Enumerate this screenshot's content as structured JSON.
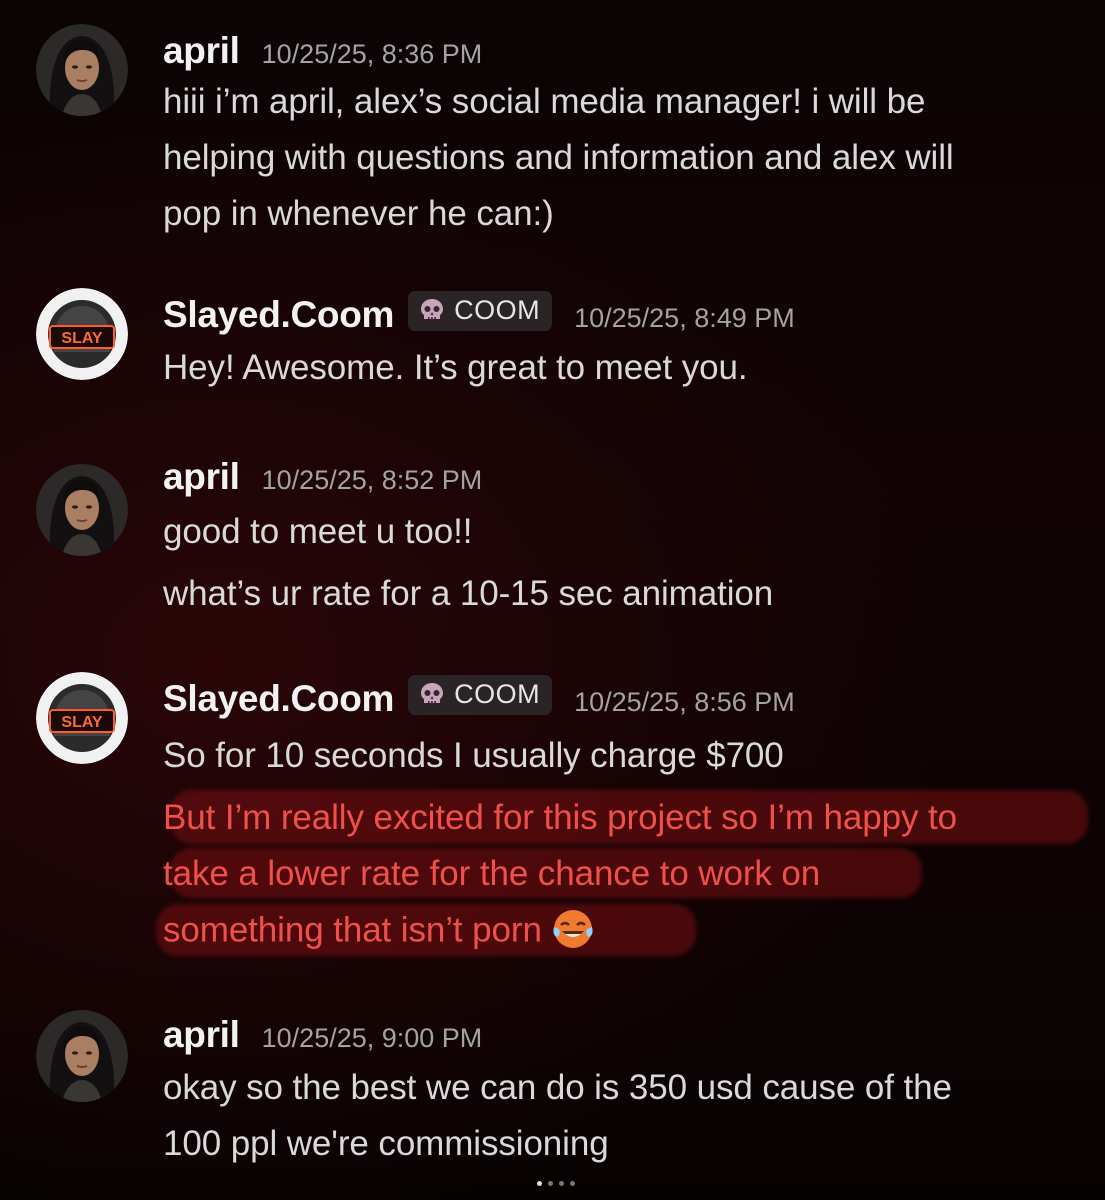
{
  "messages": [
    {
      "author": "april",
      "timestamp": "10/25/25, 8:36 PM",
      "lines": [
        "hiii i’m april, alex’s social media manager! i will be",
        "helping with questions and information and alex will",
        "pop in whenever he can:)"
      ]
    },
    {
      "author": "Slayed.Coom",
      "role_tag": "COOM",
      "role_icon": "skull-icon",
      "timestamp": "10/25/25, 8:49 PM",
      "lines": [
        "Hey! Awesome. It’s great to meet you."
      ]
    },
    {
      "author": "april",
      "timestamp": "10/25/25, 8:52 PM",
      "lines": [
        "good to meet u too!!",
        "what’s ur rate for a 10-15 sec animation"
      ]
    },
    {
      "author": "Slayed.Coom",
      "role_tag": "COOM",
      "role_icon": "skull-icon",
      "timestamp": "10/25/25, 8:56 PM",
      "lines": [
        "So for 10 seconds I usually charge $700",
        "But I’m really excited for this project so I’m happy to",
        "take a lower rate for the chance to work on",
        "something that isn’t porn"
      ],
      "highlight_color": "#f0504a",
      "emoji": "laughing-crying-emoji"
    },
    {
      "author": "april",
      "timestamp": "10/25/25, 9:00 PM",
      "lines": [
        "okay so the best we can do is 350 usd cause of the",
        "100 ppl we're commissioning"
      ]
    }
  ],
  "avatars": {
    "april": "profile-photo",
    "slayed": "slay-avatar",
    "slayed_text": "SLAY"
  },
  "carousel": {
    "total_pages": 4,
    "active_page": 1
  }
}
